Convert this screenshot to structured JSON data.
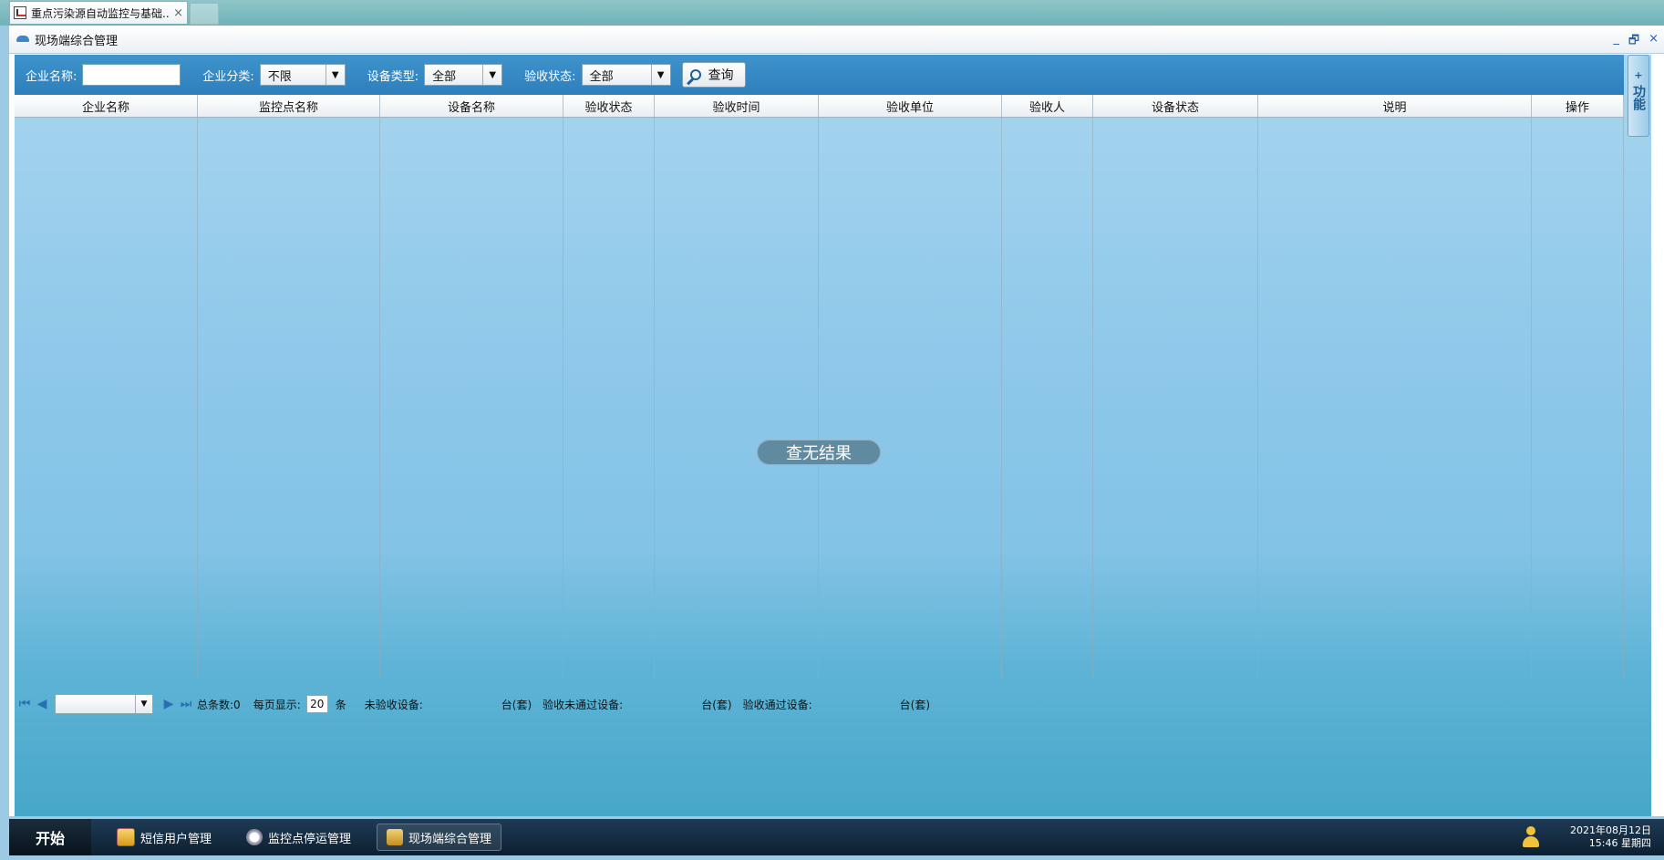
{
  "browser": {
    "tab_title": "重点污染源自动监控与基础...",
    "tab_close": "×"
  },
  "window": {
    "title": "现场端综合管理",
    "controls": [
      "_",
      "🗗",
      "×"
    ]
  },
  "toolbar": {
    "company_name_label": "企业名称:",
    "company_name_value": "",
    "category_label": "企业分类:",
    "category_value": "不限",
    "device_type_label": "设备类型:",
    "device_type_value": "全部",
    "accept_status_label": "验收状态:",
    "accept_status_value": "全部",
    "query_label": "查询"
  },
  "side_panel": {
    "plus": "+",
    "label": "功能"
  },
  "table": {
    "columns": [
      "企业名称",
      "监控点名称",
      "设备名称",
      "验收状态",
      "验收时间",
      "验收单位",
      "验收人",
      "设备状态",
      "说明",
      "操作"
    ],
    "rows": [],
    "empty_message": "查无结果"
  },
  "pager": {
    "total_label": "总条数:0",
    "per_page_label": "每页显示:",
    "per_page_value": "20",
    "unit": "条",
    "not_accepted_label": "未验收设备:",
    "not_accepted_unit": "台(套)",
    "failed_label": "验收未通过设备:",
    "failed_unit": "台(套)",
    "passed_label": "验收通过设备:",
    "passed_unit": "台(套)"
  },
  "taskbar": {
    "start": "开始",
    "tasks": [
      "短信用户管理",
      "监控点停运管理",
      "现场端综合管理"
    ],
    "date": "2021年08月12日",
    "time": "15:46 星期四"
  }
}
